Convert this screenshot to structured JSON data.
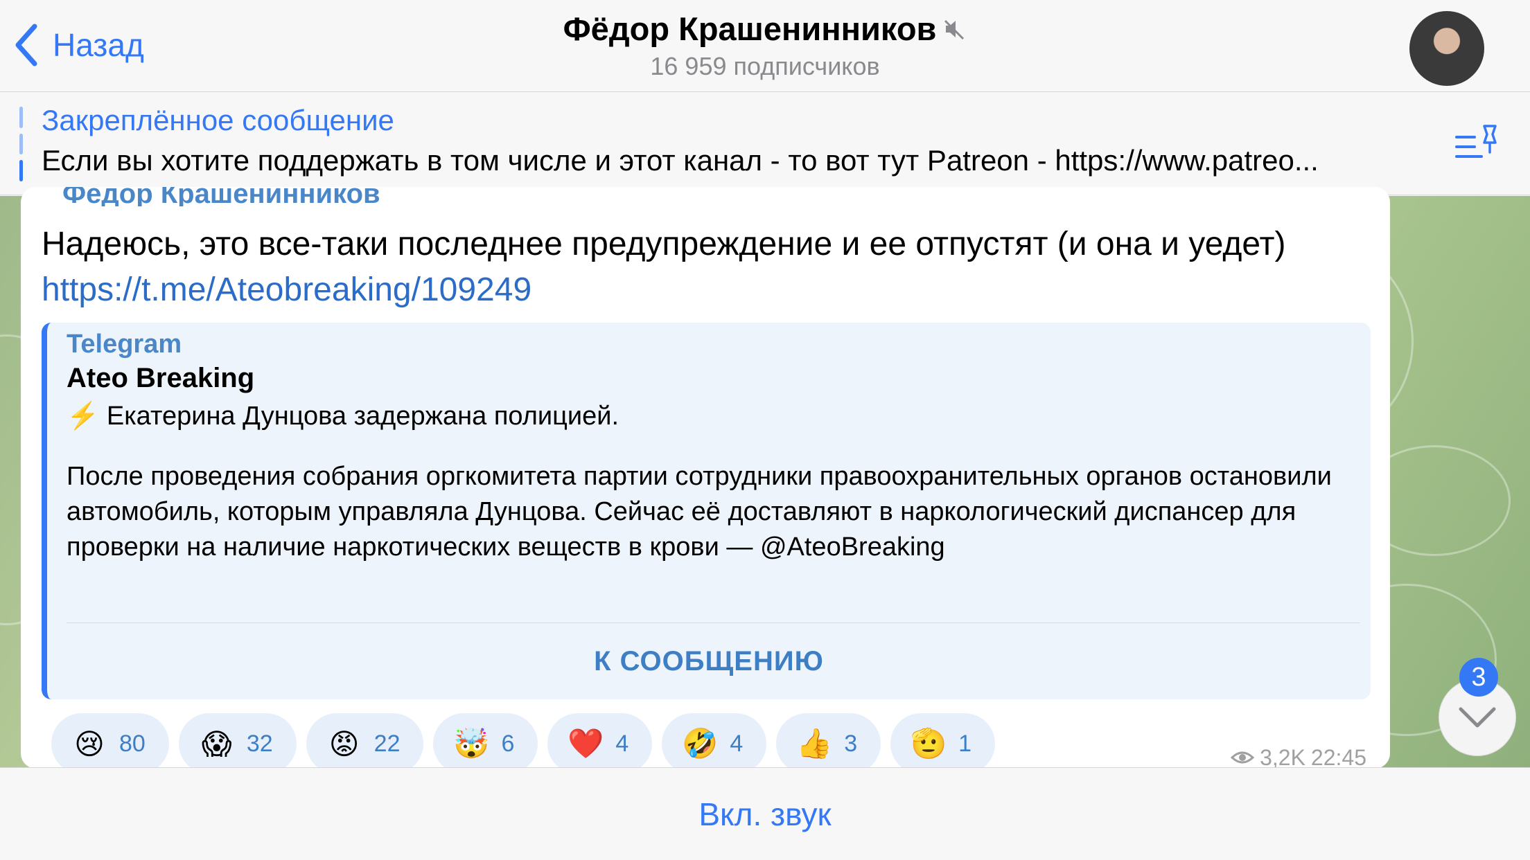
{
  "header": {
    "back_label": "Назад",
    "title": "Фёдор Крашенинников",
    "subtitle": "16 959 подписчиков"
  },
  "pinned": {
    "title": "Закреплённое сообщение",
    "text": "Если вы хотите поддержать в том числе и этот канал - то вот тут Patreon - https://www.patreo..."
  },
  "message": {
    "sender": "Фёдор Крашенинников",
    "text": "Надеюсь, это все-таки последнее предупреждение и  ее отпустят (и она и уедет) ",
    "link": "https://t.me/Ateobreaking/109249",
    "preview": {
      "site": "Telegram",
      "title": "Ateo Breaking",
      "line1": "⚡️ Екатерина Дунцова задержана полицией.",
      "body": "После проведения собрания оргкомитета партии сотрудники правоохранительных органов остановили автомобиль, которым управляла Дунцова. Сейчас её доставляют в наркологический диспансер для проверки на наличие наркотических веществ в крови — @AteoBreaking",
      "button": "К СООБЩЕНИЮ"
    },
    "reactions": [
      {
        "emoji": "😢",
        "count": "80"
      },
      {
        "emoji": "😱",
        "count": "32"
      },
      {
        "emoji": "😡",
        "count": "22"
      },
      {
        "emoji": "🤯",
        "count": "6"
      },
      {
        "emoji": "❤️",
        "count": "4"
      },
      {
        "emoji": "🤣",
        "count": "4"
      },
      {
        "emoji": "👍",
        "count": "3"
      },
      {
        "emoji": "🫡",
        "count": "1"
      }
    ],
    "views": "3,2K",
    "time": "22:45"
  },
  "scroll_badge": "3",
  "bottom": {
    "unmute_label": "Вкл. звук"
  },
  "colors": {
    "accent": "#3478f6",
    "link": "#2a6cc7",
    "sender": "#4a87c8"
  }
}
